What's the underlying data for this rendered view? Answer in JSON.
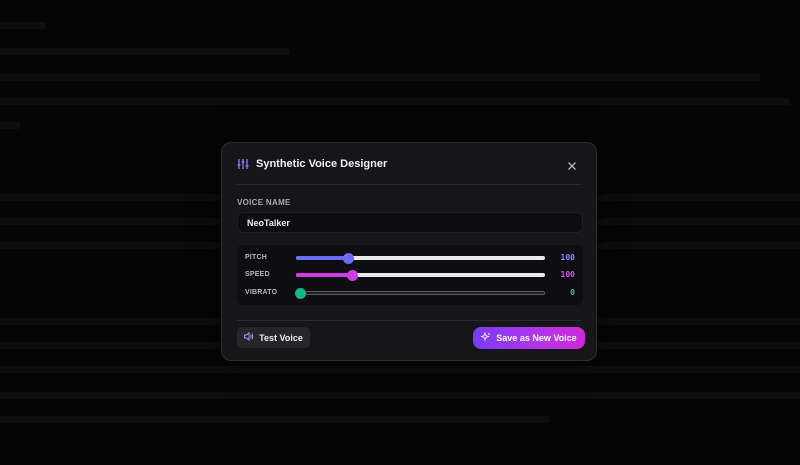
{
  "dialog": {
    "title": "Synthetic Voice Designer",
    "title_icon": "sliders-icon",
    "close_icon": "close-icon"
  },
  "voice_name": {
    "label": "VOICE NAME",
    "value": "NeoTalker"
  },
  "sliders": [
    {
      "label": "PITCH",
      "value": "100",
      "fraction": 0.21,
      "fill_color": "#6b6cf5",
      "value_color": "#8a8cff",
      "thumb_color": "#6b6cf5"
    },
    {
      "label": "SPEED",
      "value": "100",
      "fraction": 0.225,
      "fill_color": "#d23ce6",
      "value_color": "#e04ce8",
      "thumb_color": "#d23ce6"
    },
    {
      "label": "VIBRATO",
      "value": "0",
      "fraction": 0.0,
      "fill_color": "#10b981",
      "value_color": "#1fbf88",
      "thumb_color": "#10b981"
    }
  ],
  "buttons": {
    "test_label": "Test Voice",
    "test_icon": "speaker-icon",
    "save_label": "Save as New Voice",
    "save_icon": "sparkle-icon"
  }
}
